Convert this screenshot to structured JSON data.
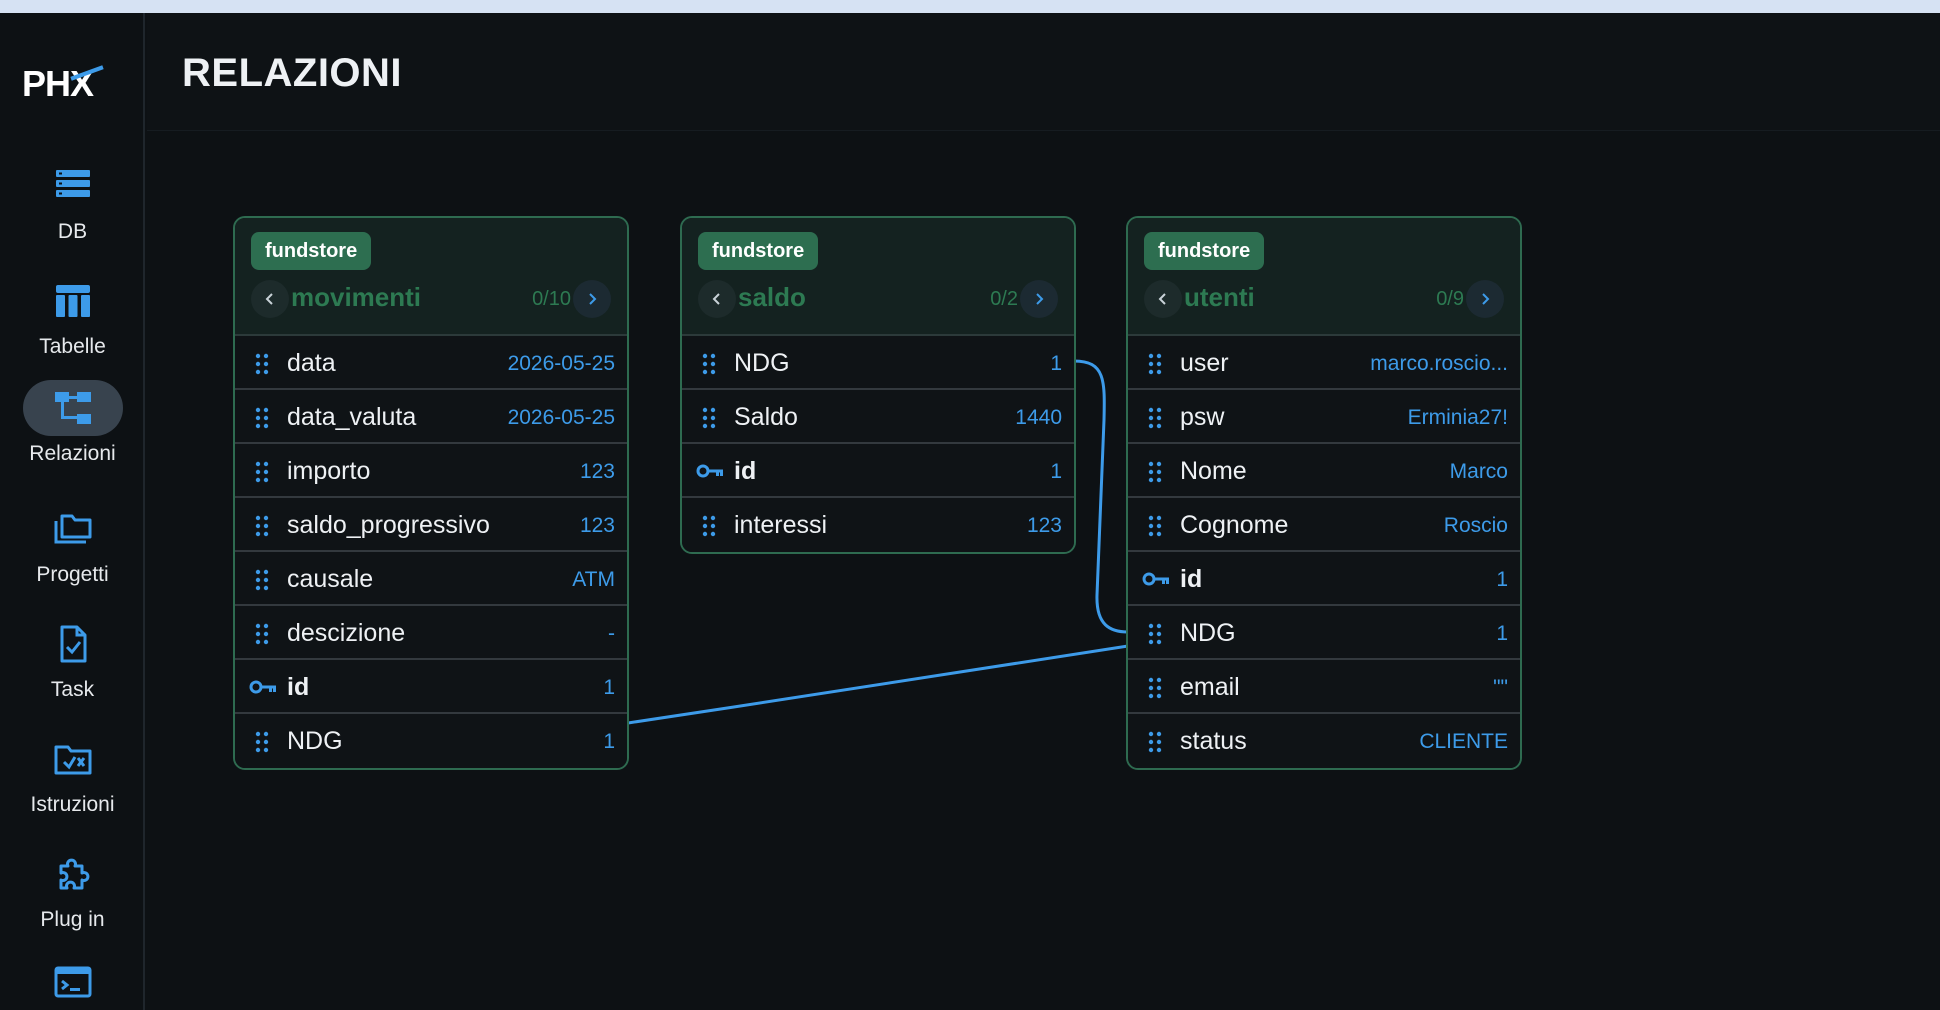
{
  "app": {
    "logo_text": "PHX"
  },
  "sidebar": {
    "items": [
      {
        "label": "DB",
        "icon": "database-icon",
        "active": false
      },
      {
        "label": "Tabelle",
        "icon": "table-icon",
        "active": false
      },
      {
        "label": "Relazioni",
        "icon": "schema-icon",
        "active": true
      },
      {
        "label": "Progetti",
        "icon": "folder-icon",
        "active": false
      },
      {
        "label": "Task",
        "icon": "task-file-icon",
        "active": false
      },
      {
        "label": "Istruzioni",
        "icon": "folder-code-icon",
        "active": false
      },
      {
        "label": "Plug in",
        "icon": "puzzle-icon",
        "active": false
      },
      {
        "label": "",
        "icon": "terminal-icon",
        "active": false
      }
    ]
  },
  "header": {
    "title": "RELAZIONI"
  },
  "colors": {
    "accent": "#3d9be9",
    "badge": "#2d6e50",
    "card_border": "#2e6b50",
    "table_name": "#2d7a52",
    "topbar": "#d6e2f3"
  },
  "tables": [
    {
      "schema": "fundstore",
      "name": "movimenti",
      "counter": "0/10",
      "fields": [
        {
          "name": "data",
          "value": "2026-05-25",
          "pk": false
        },
        {
          "name": "data_valuta",
          "value": "2026-05-25",
          "pk": false
        },
        {
          "name": "importo",
          "value": "123",
          "pk": false
        },
        {
          "name": "saldo_progressivo",
          "value": "123",
          "pk": false
        },
        {
          "name": "causale",
          "value": "ATM",
          "pk": false
        },
        {
          "name": "descizione",
          "value": "-",
          "pk": false
        },
        {
          "name": "id",
          "value": "1",
          "pk": true
        },
        {
          "name": "NDG",
          "value": "1",
          "pk": false
        }
      ]
    },
    {
      "schema": "fundstore",
      "name": "saldo",
      "counter": "0/2",
      "fields": [
        {
          "name": "NDG",
          "value": "1",
          "pk": false
        },
        {
          "name": "Saldo",
          "value": "1440",
          "pk": false
        },
        {
          "name": "id",
          "value": "1",
          "pk": true
        },
        {
          "name": "interessi",
          "value": "123",
          "pk": false
        }
      ]
    },
    {
      "schema": "fundstore",
      "name": "utenti",
      "counter": "0/9",
      "fields": [
        {
          "name": "user",
          "value": "marco.roscio...",
          "pk": false
        },
        {
          "name": "psw",
          "value": "Erminia27!",
          "pk": false
        },
        {
          "name": "Nome",
          "value": "Marco",
          "pk": false
        },
        {
          "name": "Cognome",
          "value": "Roscio",
          "pk": false
        },
        {
          "name": "id",
          "value": "1",
          "pk": true
        },
        {
          "name": "NDG",
          "value": "1",
          "pk": false
        },
        {
          "name": "email",
          "value": "\"\"",
          "pk": false
        },
        {
          "name": "status",
          "value": "CLIENTE",
          "pk": false
        }
      ]
    }
  ],
  "relations": [
    {
      "from_table": "movimenti",
      "from_field": "NDG",
      "to_table": "utenti",
      "to_field": "NDG"
    },
    {
      "from_table": "saldo",
      "from_field": "NDG",
      "to_table": "utenti",
      "to_field": "NDG"
    }
  ]
}
